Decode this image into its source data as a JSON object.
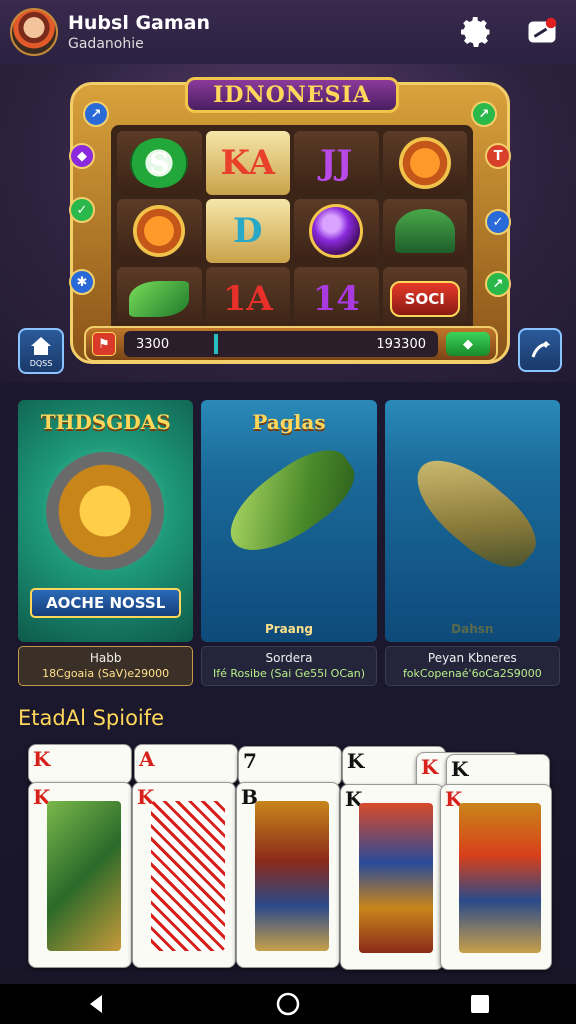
{
  "header": {
    "username": "Hubsl Gaman",
    "subtitle": "Gadanohie"
  },
  "slot": {
    "title": "IDNONESIA",
    "reels": [
      "S",
      "KA",
      "JJ",
      "",
      "",
      "D",
      "",
      "",
      "",
      "1A",
      "14",
      "SOCI"
    ],
    "balance_left": "3300",
    "balance_right": "193300",
    "home_label": "DQSS"
  },
  "games": [
    {
      "title": "THDSGDAS",
      "banner": "AOCHE NOSSL",
      "footer": "",
      "name": "Habb",
      "detail": "18Cgoaia (SaV)e29000"
    },
    {
      "title": "Paglas",
      "banner": "",
      "footer": "Praang",
      "name": "Sordera",
      "detail": "Ifé Rosibe (Sai Ge55l OCan)"
    },
    {
      "title": "",
      "banner": "",
      "footer": "Dahsn",
      "name": "Peyan Kbneres",
      "detail": "fokCopenaé'6oCa2S9000"
    }
  ],
  "section": {
    "title": "EtadAl Spioife"
  },
  "cards": [
    {
      "rank": "K",
      "color": "red"
    },
    {
      "rank": "K",
      "color": "red"
    },
    {
      "rank": "B",
      "color": "blk"
    },
    {
      "rank": "K",
      "color": "blk"
    },
    {
      "rank": "K",
      "color": "red"
    }
  ],
  "back_cards": [
    {
      "rank": "K",
      "color": "red"
    },
    {
      "rank": "A",
      "color": "red"
    },
    {
      "rank": "7",
      "color": "blk"
    },
    {
      "rank": "K",
      "color": "blk"
    },
    {
      "rank": "K",
      "color": "red"
    },
    {
      "rank": "K",
      "color": "blk"
    }
  ],
  "icons": {
    "settings": "gear-icon",
    "notifications": "notification-icon",
    "home": "home-icon",
    "action": "arrow-icon",
    "nav_back": "back-icon",
    "nav_home": "home-circle-icon",
    "nav_recent": "recent-square-icon"
  },
  "colors": {
    "accent": "#ffd75a",
    "background": "#1a1628"
  }
}
